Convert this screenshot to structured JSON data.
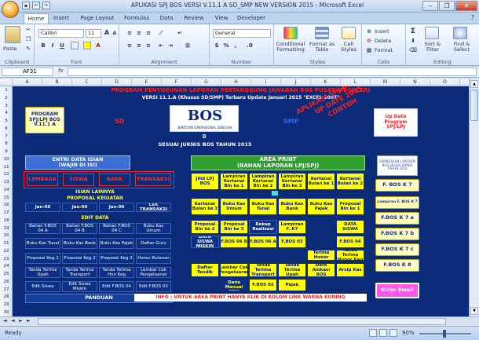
{
  "window": {
    "title": "APLIKASI SPJ BOS VERSI V.11.1 A SD_SMP NEW VERSION 2015  -  Microsoft Excel",
    "minimize": "–",
    "restore": "❐",
    "close": "✕"
  },
  "tabs": [
    "Home",
    "Insert",
    "Page Layout",
    "Formulas",
    "Data",
    "Review",
    "View",
    "Developer"
  ],
  "ribbon": {
    "clipboard": {
      "label": "Clipboard",
      "paste": "Paste"
    },
    "font": {
      "label": "Font",
      "font_name": "Calibri",
      "font_size": "11",
      "bold": "B",
      "italic": "I",
      "underline": "U",
      "grow": "A",
      "shrink": "A"
    },
    "alignment": {
      "label": "Alignment"
    },
    "number": {
      "label": "Number",
      "format": "General",
      "currency": "$",
      "percent": "%",
      "comma": ",",
      "inc_dec": ".0",
      ".00": ".00"
    },
    "styles": {
      "label": "Styles",
      "cond": "Conditional Formatting",
      "table": "Format as Table",
      "cell": "Cell Styles"
    },
    "cells": {
      "label": "Cells",
      "insert": "Insert",
      "delete": "Delete",
      "format": "Format"
    },
    "editing": {
      "label": "Editing",
      "sum": "Σ",
      "sort": "Sort & Filter",
      "find": "Find & Select"
    }
  },
  "formula_bar": {
    "name_box": "AF31",
    "fx": "fx",
    "value": ""
  },
  "columns": [
    "A",
    "B",
    "C",
    "D",
    "E",
    "F",
    "G",
    "H",
    "I",
    "J",
    "K",
    "L",
    "M",
    "N",
    "O"
  ],
  "rows": [
    "1",
    "2",
    "3",
    "4",
    "5",
    "6",
    "7",
    "8",
    "9",
    "10",
    "11",
    "12",
    "13",
    "14",
    "15",
    "16",
    "17",
    "18",
    "19",
    "20",
    "21",
    "22",
    "23",
    "24",
    "25",
    "26",
    "27",
    "28",
    "29",
    "30"
  ],
  "sheet": {
    "title": "PROGRAM PENYUSUNAN LAPORAN PERTANGGUNG JAWABAN BOS PUSAT (REGULER)",
    "version": "VERSI 11.1.A (Khusus SD/SMP) Terbaru Update Januari 2015 \"EXCEL 2007\"",
    "program_btn": "PROGRAM SPJ/LPJ BOS V.11.1 A",
    "sd": "SD",
    "smp": "SMP",
    "logo_text": "BOS",
    "logo_sub": "BANTUAN OPERASIONAL SEKOLAH",
    "zero": "0",
    "juknis": "SESUAI JUKNIS BOS TAHUN 2015",
    "watermark": [
      "APLIKASI SPJ BOS V.11",
      "UP DATE 2015",
      "CONTOH"
    ],
    "update_btn": "Up Date Program SPJ/LPJ",
    "entri_title": "ENTRI DATA ISIAN",
    "entri_sub": "(WAJIB DI ISI)",
    "entri_buttons": [
      "LEMBAGA",
      "SISWA",
      "BANK",
      "TRANSAKSI"
    ],
    "isian_lainnya": "ISIAN LAINNYA",
    "proposal_kegiatan": "PROPOSAL KEGIATAN",
    "jan_row": [
      "Jan-00",
      "Jan-00",
      "Jan-00",
      "CEK TRANSAKSI"
    ],
    "edit_data": "EDIT DATA",
    "left_grid": [
      [
        "Bahan F.BOS 04 A",
        "Bahan F.BOS 04 B",
        "Bahan F.BOS 04 C",
        "Buku Kas Umum"
      ],
      [
        "Buku Kas Tunai",
        "Buku Kas Bank",
        "Buku Kas Pajak",
        "Daftar Guru"
      ],
      [
        "Proposal Keg.1",
        "Proposal Keg.2",
        "Proposal Keg.3",
        "Honor Bulanan"
      ],
      [
        "Tanda Terima Upah",
        "Tanda Terima Transport",
        "Tanda Terima Hon Keg",
        "Lembar Cek Pengeluaran"
      ],
      [
        "Edit Siswa",
        "Edit Siswa Miskin",
        "Edit F.BOS 04",
        "Edit F.BOS 03"
      ]
    ],
    "panduan": "PANDUAN",
    "area_print_title": "AREA PRINT",
    "area_print_sub": "(BAHAN LAPORAN LPJ/SPJ)",
    "print_row1": [
      "Jilid LPJ BOS",
      "Lampiran Kertanai Bln ke 1",
      "Lampiran Kertanai Bln ke 2",
      "Lampiran Kertanai Bln ke 3",
      "Kertanai Bulan ke 1",
      "Kertanai Bulan ke 2"
    ],
    "print_row2": [
      "Kertanai Bulan ke 3",
      "Buku Kas Umum",
      "Buku Kas Tunai",
      "Buku Kas Bank",
      "Buku Kas Pajak",
      "Proposal Bln ke 1"
    ],
    "print_row3": [
      "Proposal Bln ke 2",
      "Proposal Bln ke 3",
      "Rekap Realisasi",
      "Lampiran F. K7",
      "DATA SISWA"
    ],
    "print_row4": [
      "DATA SISWA MISKIN",
      "F.BOS 06 B",
      "F.BOS 06 A",
      "F.BOS 03",
      "F.BOS 04"
    ],
    "print_row5": [
      "Tanda Terima Honor Rutin",
      "Tanda Terima Honor Keg"
    ],
    "print_row6": [
      "Daftar Tendik",
      "Lembar Cek Pengeluaran",
      "Tanda Terima Transport",
      "Tanda Terima Upah",
      "Data Alokasi BOS",
      "Arsip Kas"
    ],
    "print_row7": [
      "Realisasi Dana Manual SPM",
      "F.BOS 02",
      "Pajak"
    ],
    "info": "INFO : UNTUK AREA PRINT HANYA KLIK DI KOLOM LINK WARNA KUNING",
    "right_small": "PEMBUKAAN LAPORAN BOS SESUAI JUKNIS TAHUN 2014",
    "right_buttons": [
      "F. BOS K 7",
      "Lampiran F. BOS K 7",
      "F.BOS K 7 a",
      "F.BOS K 7 b",
      "F.BOS K 7 c",
      "F.BOS K 8"
    ],
    "kirim_email": "Kirim Email"
  },
  "sheet_tabs": [
    "◄",
    "◄",
    "►",
    "►"
  ],
  "status": {
    "ready": "Ready",
    "zoom": "90%"
  }
}
